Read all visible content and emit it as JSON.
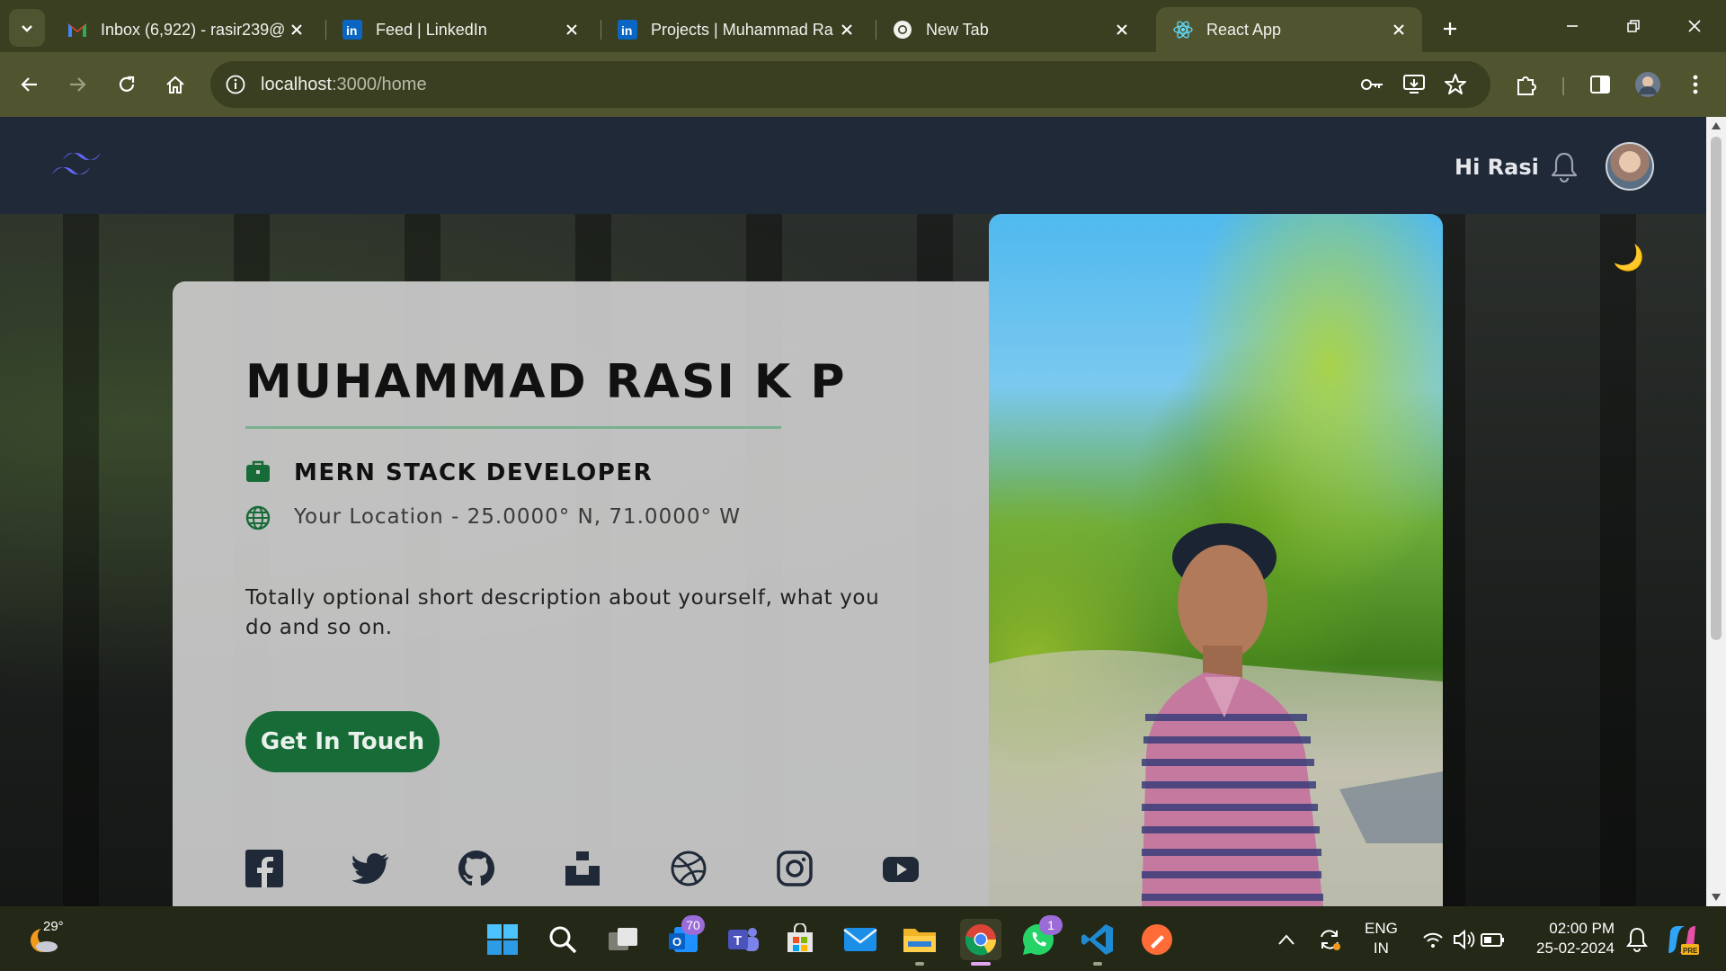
{
  "browser": {
    "tabs": [
      {
        "title": "Inbox (6,922) - rasir239@",
        "favicon": "gmail-icon"
      },
      {
        "title": "Feed | LinkedIn",
        "favicon": "linkedin-icon"
      },
      {
        "title": "Projects | Muhammad Ra",
        "favicon": "linkedin-icon"
      },
      {
        "title": "New Tab",
        "favicon": "chrome-icon"
      },
      {
        "title": "React App",
        "favicon": "react-icon",
        "active": true
      }
    ],
    "address": {
      "host": "localhost",
      "path": ":3000/home"
    }
  },
  "site": {
    "greeting": "Hi Rasi",
    "name": "MUHAMMAD RASI K P",
    "role": "MERN STACK DEVELOPER",
    "location": "Your Location - 25.0000° N, 71.0000° W",
    "description": "Totally optional short description about yourself, what you do and so on.",
    "cta_label": "Get In Touch",
    "socials": [
      "facebook-icon",
      "twitter-icon",
      "github-icon",
      "unsplash-icon",
      "dribbble-icon",
      "instagram-icon",
      "youtube-icon"
    ],
    "theme_toggle": "🌙"
  },
  "taskbar": {
    "weather_temp": "29°",
    "mail_badge": "70",
    "whatsapp_badge": "1",
    "lang_top": "ENG",
    "lang_bottom": "IN",
    "time": "02:00 PM",
    "date": "25-02-2024"
  },
  "colors": {
    "tabstrip": "#3b3f21",
    "toolbar": "#50552f",
    "site_nav": "#1f2937",
    "accent_green": "#176b37",
    "rule_green": "#7ab08f"
  }
}
